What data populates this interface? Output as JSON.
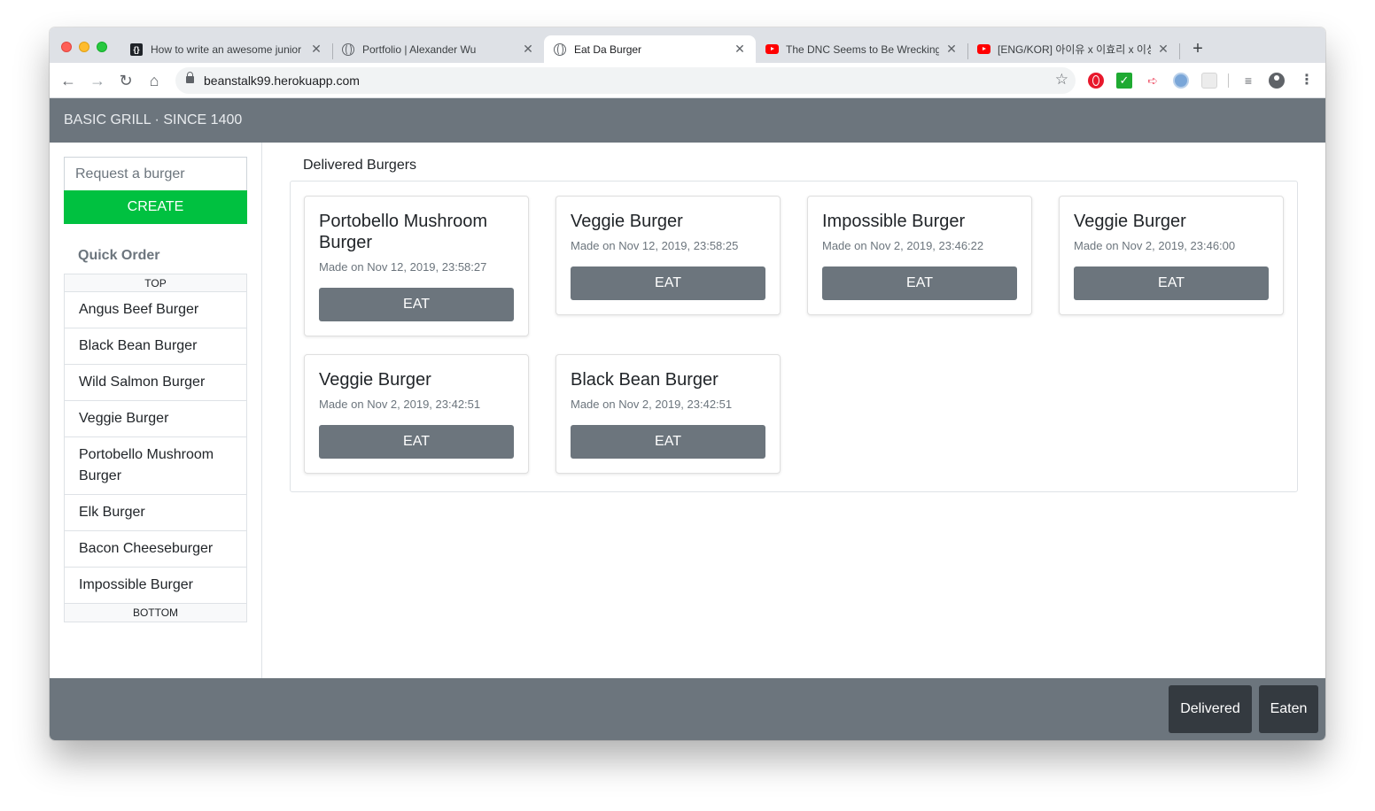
{
  "browser": {
    "tabs": [
      {
        "title": "How to write an awesome junior",
        "favicon": "codepen-icon",
        "active": false
      },
      {
        "title": "Portfolio | Alexander Wu",
        "favicon": "globe-icon",
        "active": false
      },
      {
        "title": "Eat Da Burger",
        "favicon": "globe-icon",
        "active": true
      },
      {
        "title": "The DNC Seems to Be Wrecking",
        "favicon": "youtube-icon",
        "active": false
      },
      {
        "title": "[ENG/KOR] 아이유 x 이효리 x 이상",
        "favicon": "youtube-icon",
        "active": false
      }
    ],
    "url": "beanstalk99.herokuapp.com"
  },
  "navbar": {
    "brand": "BASIC GRILL · SINCE 1400"
  },
  "sidebar": {
    "request_placeholder": "Request a burger",
    "create_label": "CREATE",
    "quick_order_title": "Quick Order",
    "top_label": "TOP",
    "bottom_label": "BOTTOM",
    "items": [
      "Angus Beef Burger",
      "Black Bean Burger",
      "Wild Salmon Burger",
      "Veggie Burger",
      "Portobello Mushroom Burger",
      "Elk Burger",
      "Bacon Cheeseburger",
      "Impossible Burger"
    ]
  },
  "main": {
    "section_title": "Delivered Burgers",
    "cards": [
      {
        "name": "Portobello Mushroom Burger",
        "date": "Made on Nov 12, 2019, 23:58:27",
        "button": "EAT"
      },
      {
        "name": "Veggie Burger",
        "date": "Made on Nov 12, 2019, 23:58:25",
        "button": "EAT"
      },
      {
        "name": "Impossible Burger",
        "date": "Made on Nov 2, 2019, 23:46:22",
        "button": "EAT"
      },
      {
        "name": "Veggie Burger",
        "date": "Made on Nov 2, 2019, 23:46:00",
        "button": "EAT"
      },
      {
        "name": "Veggie Burger",
        "date": "Made on Nov 2, 2019, 23:42:51",
        "button": "EAT"
      },
      {
        "name": "Black Bean Burger",
        "date": "Made on Nov 2, 2019, 23:42:51",
        "button": "EAT"
      }
    ]
  },
  "footer": {
    "delivered_label": "Delivered",
    "eaten_label": "Eaten"
  },
  "colors": {
    "navbar": "#6c757d",
    "create_button": "#00c140",
    "footer_button": "#343a40"
  }
}
